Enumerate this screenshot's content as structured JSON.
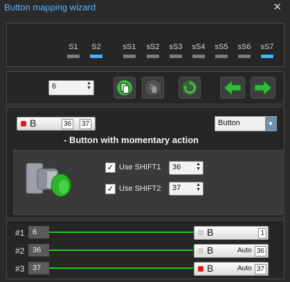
{
  "window": {
    "title": "Button mapping wizard",
    "close": "✕"
  },
  "shifts": [
    {
      "label": "S1",
      "active": false
    },
    {
      "label": "S2",
      "active": true
    },
    {
      "label": "sS1",
      "active": false
    },
    {
      "label": "sS2",
      "active": false
    },
    {
      "label": "sS3",
      "active": false
    },
    {
      "label": "sS4",
      "active": false
    },
    {
      "label": "sS5",
      "active": false
    },
    {
      "label": "sS6",
      "active": false
    },
    {
      "label": "sS7",
      "active": true
    }
  ],
  "toolbar": {
    "button_number": "6",
    "icons": [
      "copy-icon",
      "paste-icon",
      "refresh-icon",
      "arrow-left-icon",
      "arrow-right-icon"
    ]
  },
  "editor": {
    "button_name": "B",
    "num_a": "36",
    "num_b": "37",
    "type_value": "Button",
    "description": "- Button with momentary action",
    "shift1": {
      "label": "Use SHIFT1",
      "checked": true,
      "value": "36"
    },
    "shift2": {
      "label": "Use SHIFT2",
      "checked": true,
      "value": "37"
    },
    "indicator_color": "#e01b1b"
  },
  "mappings": [
    {
      "label": "#1",
      "num": "6",
      "name": "B",
      "mode": "",
      "value": "1",
      "color": "#cfcfcf"
    },
    {
      "label": "#2",
      "num": "36",
      "name": "B",
      "mode": "Auto",
      "value": "36",
      "color": "#cfcfcf"
    },
    {
      "label": "#3",
      "num": "37",
      "name": "B",
      "mode": "Auto",
      "value": "37",
      "color": "#e01b1b"
    }
  ]
}
